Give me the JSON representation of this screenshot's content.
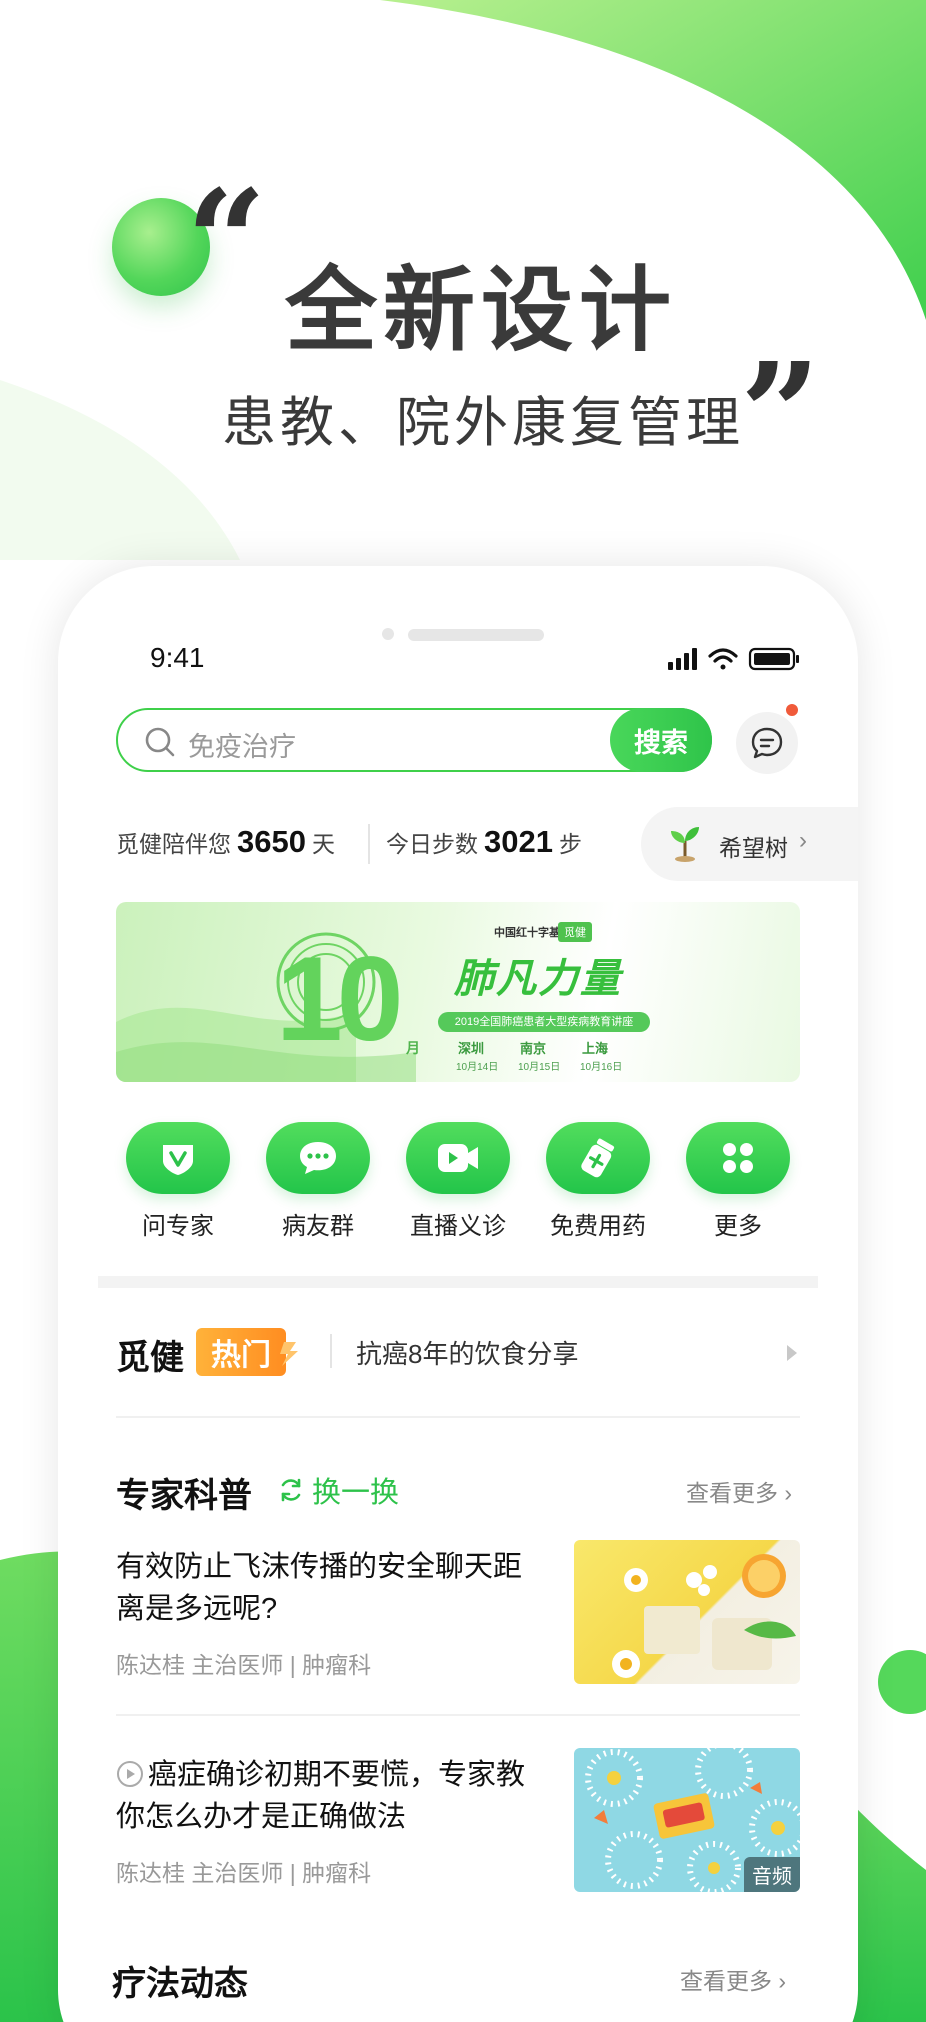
{
  "hero": {
    "title": "全新设计",
    "subtitle": "患教、院外康复管理",
    "quote_open": "“",
    "quote_close": "”"
  },
  "status_bar": {
    "time": "9:41"
  },
  "search": {
    "placeholder": "免疫治疗",
    "button_label": "搜索"
  },
  "stats": {
    "companion_label": "觅健陪伴您",
    "companion_value": "3650",
    "companion_unit": "天",
    "steps_label": "今日步数",
    "steps_value": "3021",
    "steps_unit": "步",
    "hope_tree_label": "希望树"
  },
  "banner": {
    "number": "10",
    "month": "月",
    "title": "肺凡力量",
    "foundation": "中国红十字基金会",
    "brand": "觅健",
    "strip": "2019全国肺癌患者大型疾病教育讲座",
    "cities": [
      {
        "name": "深圳",
        "date": "10月14日"
      },
      {
        "name": "南京",
        "date": "10月15日"
      },
      {
        "name": "上海",
        "date": "10月16日"
      }
    ]
  },
  "quick_menu": [
    {
      "label": "问专家",
      "icon": "v-shield-icon"
    },
    {
      "label": "病友群",
      "icon": "chat-bubble-icon"
    },
    {
      "label": "直播义诊",
      "icon": "video-camera-icon"
    },
    {
      "label": "免费用药",
      "icon": "medicine-bottle-icon"
    },
    {
      "label": "更多",
      "icon": "clover-icon"
    }
  ],
  "hot": {
    "brand": "觅健",
    "badge": "热门",
    "text": "抗癌8年的饮食分享"
  },
  "expert": {
    "title": "专家科普",
    "refresh_label": "换一换",
    "see_more": "查看更多",
    "articles": [
      {
        "title": "有效防止飞沫传播的安全聊天距离是多远呢?",
        "meta": "陈达桂  主治医师 | 肿瘤科",
        "tag": ""
      },
      {
        "title": "癌症确诊初期不要慌，专家教你怎么办才是正确做法",
        "meta": "陈达桂  主治医师 | 肿瘤科",
        "tag": "音频"
      }
    ]
  },
  "therapy": {
    "title": "疗法动态",
    "see_more": "查看更多"
  },
  "colors": {
    "brand_green": "#2dc24a",
    "hot_orange": "#ff9a25",
    "text_dark": "#111111"
  }
}
